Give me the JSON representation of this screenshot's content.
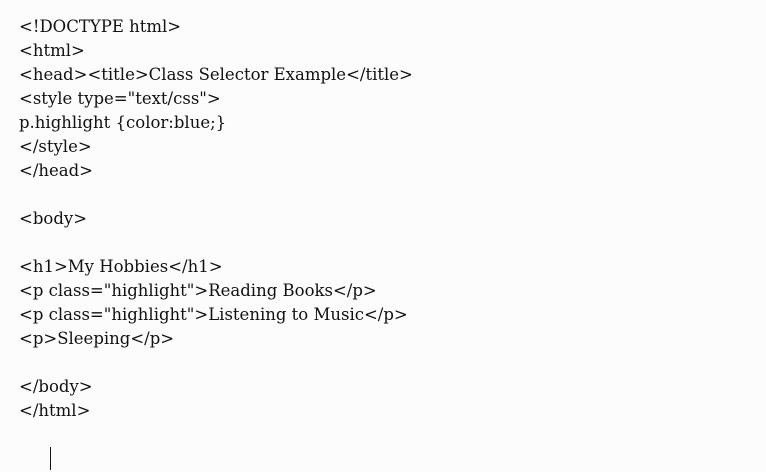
{
  "document": {
    "lines": [
      "<!DOCTYPE html>",
      "<html>",
      "<head><title>Class Selector Example</title>",
      "<style type=\"text/css\">",
      "p.highlight {color:blue;}",
      "</style>",
      "</head>",
      "",
      "<body>",
      "",
      "<h1>My Hobbies</h1>",
      "<p class=\"highlight\">Reading Books</p>",
      "<p class=\"highlight\">Listening to Music</p>",
      "<p>Sleeping</p>",
      "",
      "</body>",
      "</html>",
      ""
    ]
  }
}
